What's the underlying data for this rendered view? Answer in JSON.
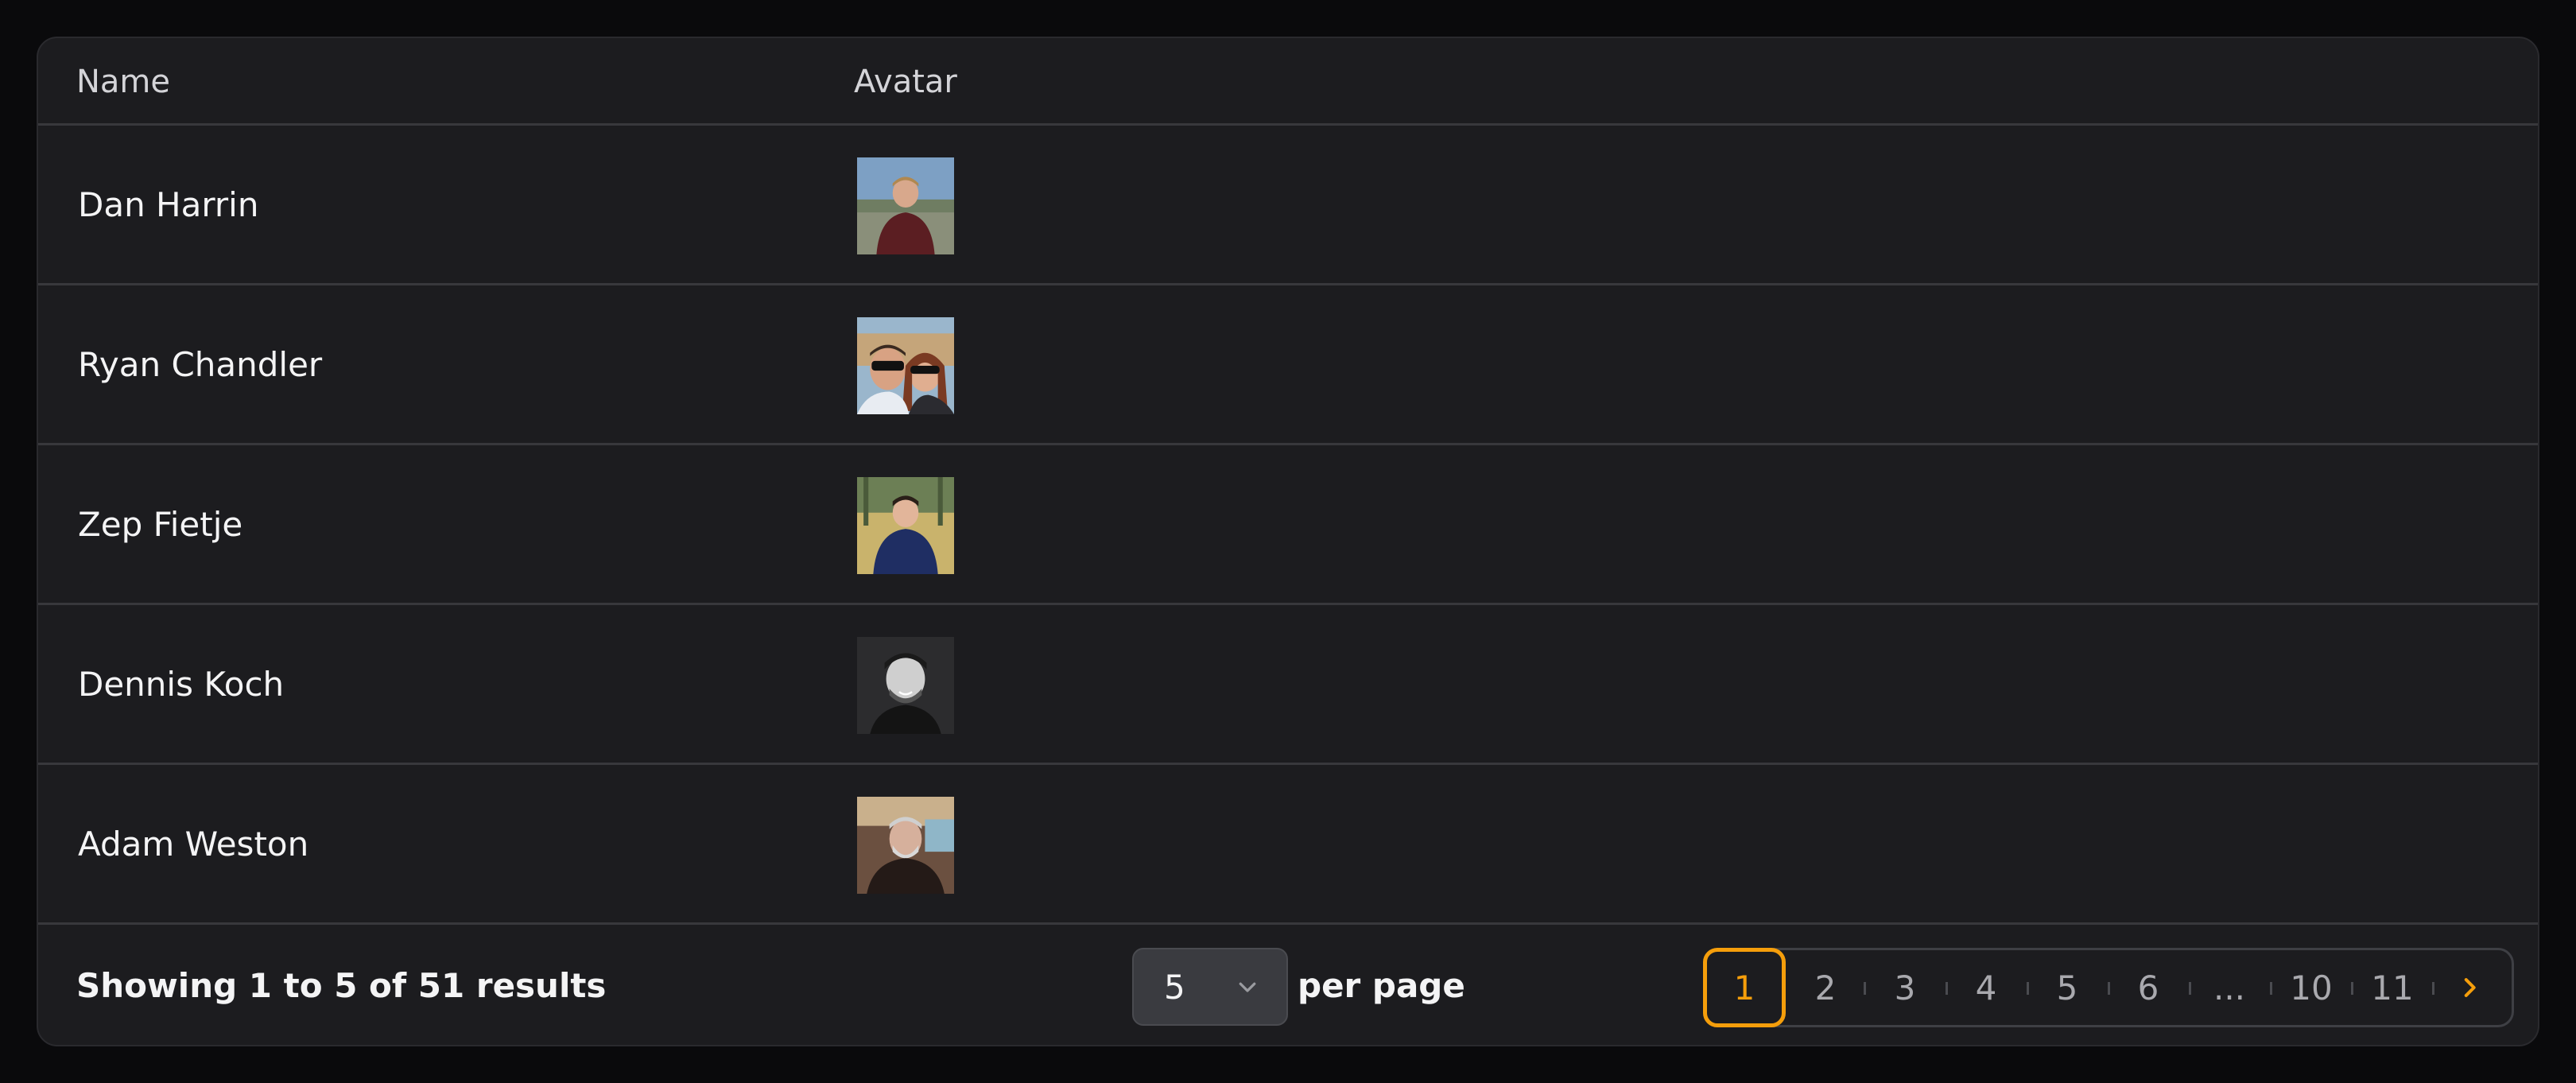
{
  "table": {
    "columns": {
      "name": "Name",
      "avatar": "Avatar"
    },
    "rows": [
      {
        "name": "Dan Harrin",
        "avatar": "avatar-photo-man-outdoor"
      },
      {
        "name": "Ryan Chandler",
        "avatar": "avatar-photo-couple-sunglasses"
      },
      {
        "name": "Zep Fietje",
        "avatar": "avatar-photo-man-blue-sweater"
      },
      {
        "name": "Dennis Koch",
        "avatar": "avatar-photo-man-grayscale"
      },
      {
        "name": "Adam Weston",
        "avatar": "avatar-photo-man-grey-beard"
      }
    ]
  },
  "footer": {
    "summary": "Showing 1 to 5 of 51 results",
    "per_page_value": "5",
    "per_page_label": "per page",
    "pages": [
      "1",
      "2",
      "3",
      "4",
      "5",
      "6",
      "...",
      "10",
      "11"
    ],
    "current_page": "1",
    "accent_color": "#f59e0b"
  }
}
